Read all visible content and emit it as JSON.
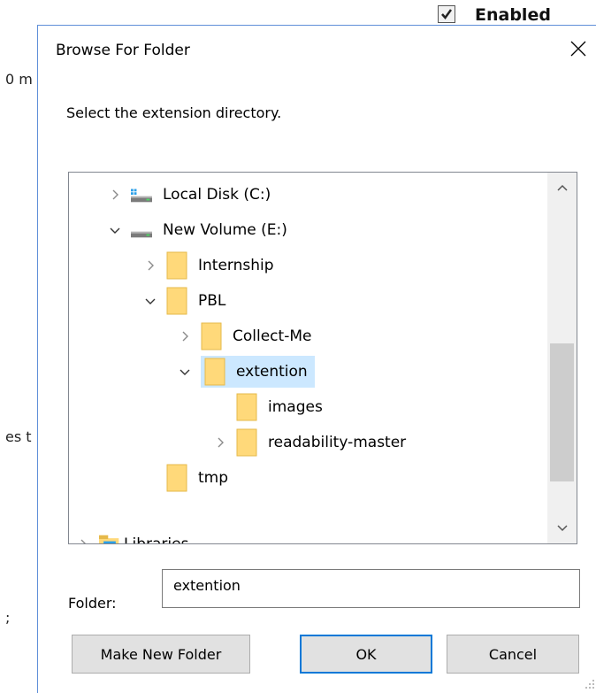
{
  "background": {
    "enabled_checkbox_label": "Enabled",
    "fragment_1": "0 m",
    "fragment_2": "es t",
    "fragment_3": ";"
  },
  "dialog": {
    "title": "Browse For Folder",
    "close_icon": "close-icon",
    "instruction": "Select the extension directory.",
    "tree": {
      "items": [
        {
          "label": "Local Disk (C:)",
          "icon": "drive-icon",
          "expander": "collapsed"
        },
        {
          "label": "New Volume (E:)",
          "icon": "drive-icon",
          "expander": "expanded"
        },
        {
          "label": "Internship",
          "icon": "folder-icon",
          "expander": "collapsed"
        },
        {
          "label": "PBL",
          "icon": "folder-icon",
          "expander": "expanded"
        },
        {
          "label": "Collect-Me",
          "icon": "folder-icon",
          "expander": "collapsed"
        },
        {
          "label": "extention",
          "icon": "folder-icon",
          "expander": "expanded",
          "selected": true
        },
        {
          "label": "images",
          "icon": "folder-icon",
          "expander": "none"
        },
        {
          "label": "readability-master",
          "icon": "folder-icon",
          "expander": "collapsed"
        },
        {
          "label": "tmp",
          "icon": "folder-icon",
          "expander": "none"
        },
        {
          "label": "Libraries",
          "icon": "libraries-icon",
          "expander": "collapsed"
        }
      ]
    },
    "folder_label": "Folder:",
    "folder_value": "extention",
    "buttons": {
      "make_new_folder": "Make New Folder",
      "ok": "OK",
      "cancel": "Cancel"
    }
  },
  "colors": {
    "accent": "#0078d7",
    "selection": "#cce8ff",
    "folder": "#ffd97a"
  }
}
